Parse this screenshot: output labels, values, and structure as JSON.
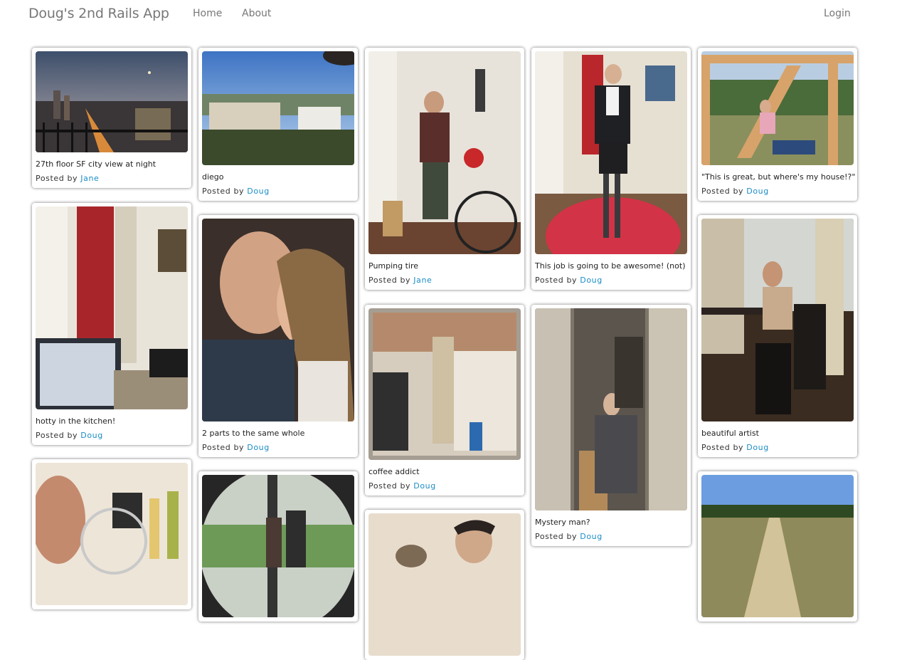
{
  "app": {
    "brand": "Doug's 2nd Rails App",
    "nav": [
      "Home",
      "About"
    ],
    "login": "Login"
  },
  "posted_by_label": "Posted by",
  "pins": [
    {
      "caption": "27th floor SF city view at night",
      "author": "Jane"
    },
    {
      "caption": "hotty in the kitchen!",
      "author": "Doug"
    },
    {
      "caption": "",
      "author": ""
    },
    {
      "caption": "diego",
      "author": "Doug"
    },
    {
      "caption": "2 parts to the same whole",
      "author": "Doug"
    },
    {
      "caption": "",
      "author": ""
    },
    {
      "caption": "Pumping tire",
      "author": "Jane"
    },
    {
      "caption": "coffee addict",
      "author": "Doug"
    },
    {
      "caption": "",
      "author": ""
    },
    {
      "caption": "This job is going to be awesome! (not)",
      "author": "Doug"
    },
    {
      "caption": "Mystery man?",
      "author": "Doug"
    },
    {
      "caption": "\"This is great, but where's my house!?\"",
      "author": "Doug"
    },
    {
      "caption": "beautiful artist",
      "author": "Doug"
    },
    {
      "caption": "",
      "author": ""
    }
  ]
}
